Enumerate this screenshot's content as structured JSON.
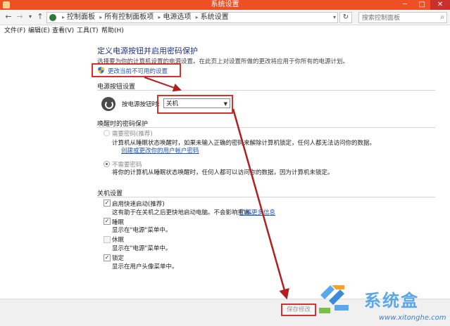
{
  "window": {
    "title": "系统设置"
  },
  "address": {
    "crumbs": [
      "控制面板",
      "所有控制面板项",
      "电源选项",
      "系统设置"
    ],
    "search_placeholder": "搜索控制面板"
  },
  "menu": [
    "文件(F)",
    "编辑(E)",
    "查看(V)",
    "工具(T)",
    "帮助(H)"
  ],
  "heading": "定义电源按钮并启用密码保护",
  "description": "选择要为你的计算机设置的电源设置。在此页上对设置所做的更改将应用于你所有的电源计划。",
  "change_settings_link": "更改当前不可用的设置",
  "power_buttons": {
    "section_title": "电源按钮设置",
    "label": "按电源按钮时:",
    "selected": "关机"
  },
  "wake_password": {
    "section_title": "唤醒时的密码保护",
    "require": {
      "label": "需要密码(推荐)",
      "desc": "计算机从睡眠状态唤醒时，如果未输入正确的密码来解除计算机锁定，任何人都无法访问你的数据。",
      "link": "创建或更改你的用户帐户密码"
    },
    "no_require": {
      "label": "不需要密码",
      "desc": "将你的计算机从睡眠状态唤醒时，任何人都可以访问你的数据，因为计算机未锁定。"
    }
  },
  "shutdown": {
    "section_title": "关机设置",
    "fast_startup": {
      "label": "启用快速启动(推荐)",
      "desc": "这有助于在关机之后更快地启动电脑。不会影响重启。",
      "link": "了解更多信息"
    },
    "sleep": {
      "label": "睡眠",
      "desc": "显示在\"电源\"菜单中。"
    },
    "hibernate": {
      "label": "休眠",
      "desc": "显示在\"电源\"菜单中。"
    },
    "lock": {
      "label": "锁定",
      "desc": "显示在用户头像菜单中。"
    }
  },
  "footer": {
    "save_label": "保存修改"
  },
  "watermark": {
    "text": "系统盒",
    "url": "www.xitonghe.com"
  },
  "colors": {
    "title_bar": "#ef4f24",
    "highlight": "#d8302c",
    "link": "#1f58b8",
    "heading": "#1e3287"
  },
  "icons": [
    "back-arrow-icon",
    "forward-arrow-icon",
    "up-arrow-icon",
    "control-panel-icon",
    "refresh-icon",
    "search-icon",
    "shield-icon",
    "power-icon",
    "checkmark-icon"
  ]
}
